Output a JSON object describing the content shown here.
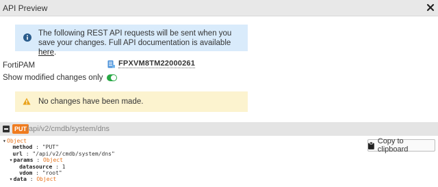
{
  "dialog": {
    "title": "API Preview"
  },
  "info": {
    "message": "The following REST API requests will be sent when you save your changes. Full API documentation is available ",
    "link_text": "here",
    "suffix": "."
  },
  "device": {
    "label": "FortiPAM",
    "name": "FPXVM8TM22000261"
  },
  "toggle": {
    "label": "Show modified changes only",
    "on": true
  },
  "warning": {
    "message": "No changes have been made."
  },
  "request": {
    "method": "PUT",
    "path": "/api/v2/cmdb/system/dns"
  },
  "tree": {
    "root_type": "Object",
    "method_key": "method",
    "method_value": "\"PUT\"",
    "url_key": "url",
    "url_value": "\"/api/v2/cmdb/system/dns\"",
    "params_key": "params",
    "params_type": "Object",
    "datasource_key": "datasource",
    "datasource_value": "1",
    "vdom_key": "vdom",
    "vdom_value": "\"root\"",
    "data_key": "data",
    "data_type": "Object"
  },
  "copy_button": {
    "label": "Copy to clipboard"
  },
  "colors": {
    "info_bg": "#d9ebfb",
    "warn_bg": "#fcf3cf",
    "toggle_on": "#27a844",
    "method_badge": "#f07b1e"
  }
}
